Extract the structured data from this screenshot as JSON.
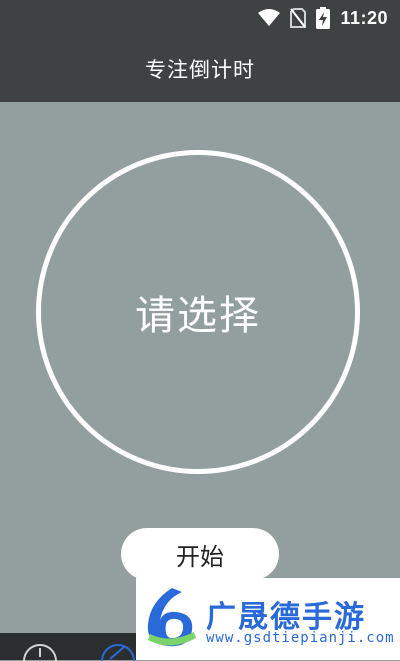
{
  "status_bar": {
    "time": "11:20",
    "icons": [
      "wifi-icon",
      "no-sim-icon",
      "battery-charging-icon"
    ]
  },
  "toolbar": {
    "title": "专注倒计时"
  },
  "timer": {
    "display_text": "请选择"
  },
  "actions": {
    "start_label": "开始"
  },
  "bottom_nav": {
    "icons": [
      "clock-icon",
      "chart-icon"
    ],
    "active_color": "#2a6ad8"
  },
  "watermark": {
    "title": "广晟德手游",
    "url": "www.gsdtiepianji.com",
    "brand_color": "#2a6ad8"
  },
  "colors": {
    "background": "#939e9e",
    "bar": "#3e4243"
  }
}
